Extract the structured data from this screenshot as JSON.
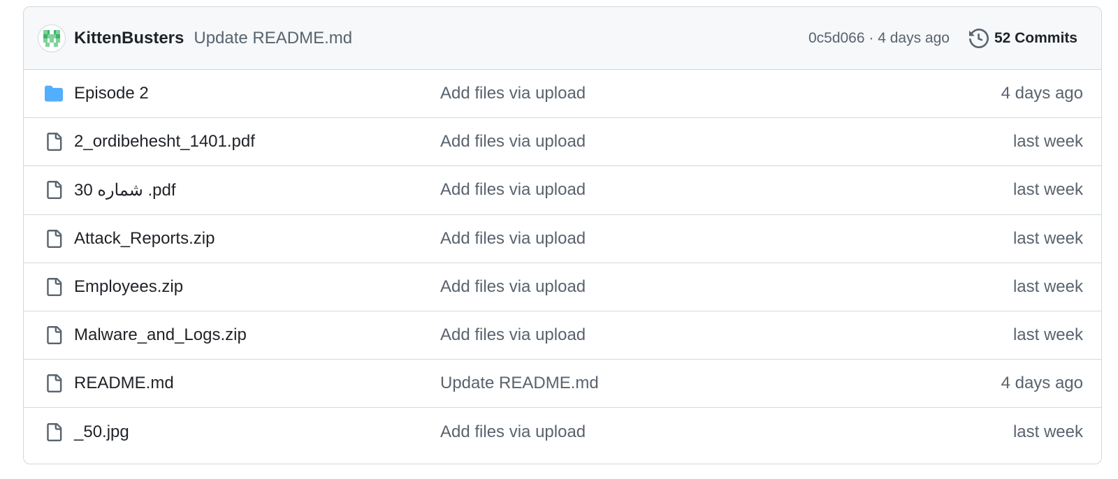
{
  "commit": {
    "author": "KittenBusters",
    "message": "Update README.md",
    "sha_age": "0c5d066 · 4 days ago",
    "commits_label": "52 Commits"
  },
  "files": [
    {
      "name": "Episode 2",
      "type": "folder",
      "message": "Add files via upload",
      "date": "4 days ago"
    },
    {
      "name": "2_ordibehesht_1401.pdf",
      "type": "file",
      "message": "Add files via upload",
      "date": "last week"
    },
    {
      "name": "30 شماره .pdf",
      "type": "file",
      "message": "Add files via upload",
      "date": "last week"
    },
    {
      "name": "Attack_Reports.zip",
      "type": "file",
      "message": "Add files via upload",
      "date": "last week"
    },
    {
      "name": "Employees.zip",
      "type": "file",
      "message": "Add files via upload",
      "date": "last week"
    },
    {
      "name": "Malware_and_Logs.zip",
      "type": "file",
      "message": "Add files via upload",
      "date": "last week"
    },
    {
      "name": "README.md",
      "type": "file",
      "message": "Update README.md",
      "date": "4 days ago"
    },
    {
      "name": "_50.jpg",
      "type": "file",
      "message": "Add files via upload",
      "date": "last week"
    }
  ],
  "colors": {
    "folder": "#54aeff",
    "border": "#d0d7de",
    "header_bg": "#f6f8fa",
    "muted_text": "#59636e"
  }
}
